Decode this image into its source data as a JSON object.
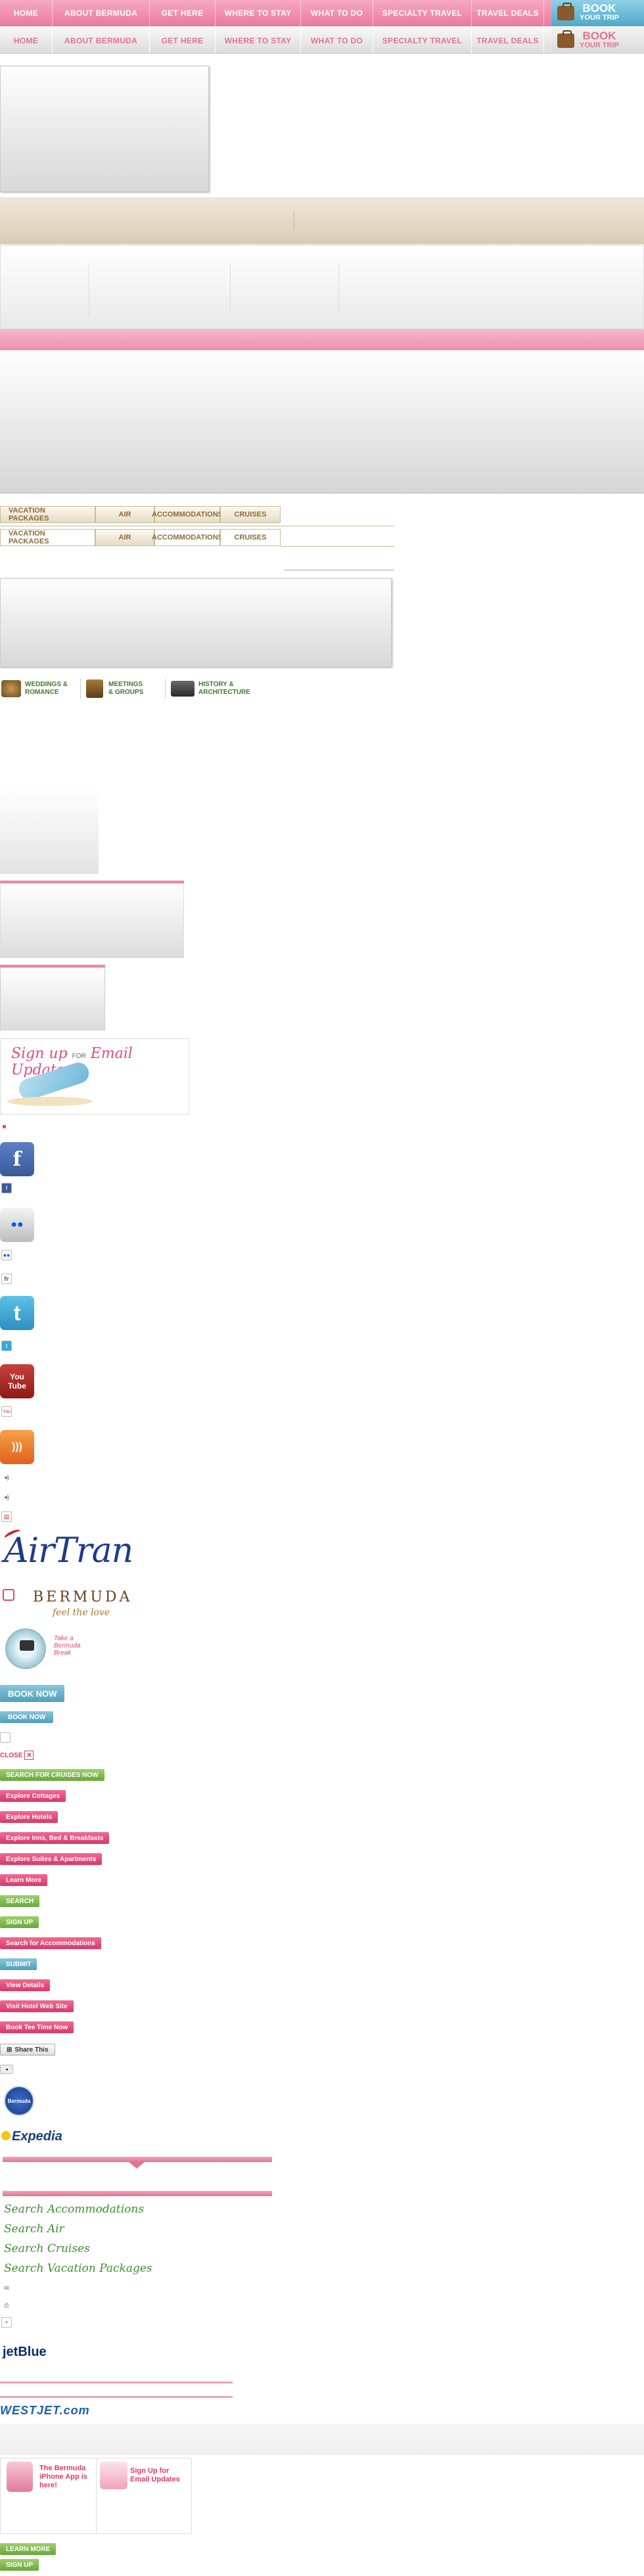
{
  "nav": {
    "items": [
      "HOME",
      "ABOUT BERMUDA",
      "GET HERE",
      "WHERE TO STAY",
      "WHAT TO DO",
      "SPECIALTY TRAVEL",
      "TRAVEL DEALS"
    ],
    "book_line1": "BOOK",
    "book_line2": "YOUR TRIP"
  },
  "tabs": [
    "VACATION PACKAGES",
    "AIR",
    "ACCOMMODATIONS",
    "CRUISES"
  ],
  "links": {
    "weddings": "WEDDINGS & ROMANCE",
    "meetings": "MEETINGS & GROUPS",
    "history": "HISTORY & ARCHITECTURE"
  },
  "signup_banner": {
    "line1": "Sign up",
    "for": "FOR",
    "line2": "Email Updates"
  },
  "social": {
    "facebook": "f",
    "flickr": "●●",
    "twitter": "t",
    "youtube": "You Tube",
    "rss": ")))"
  },
  "mini": {
    "flickr": "flr",
    "youtube": "You"
  },
  "logos": {
    "airtran": "AirTran",
    "bermuda": "BERMUDA",
    "bermuda_tag": "feel the love",
    "break_line1": "Take a",
    "break_line2": "Bermuda",
    "break_line3": "Break",
    "expedia": "Expedia",
    "jetblue": "jetBlue",
    "westjet": "WESTJET.com",
    "seal": "Bermuda"
  },
  "buttons": {
    "book_now_big": "BOOK NOW",
    "book_now_small": "BOOK NOW",
    "close": "CLOSE",
    "search_cruises": "SEARCH FOR CRUISES NOW",
    "explore_cottages": "Explore Cottages",
    "explore_hotels": "Explore Hotels",
    "explore_inns": "Explore Inns, Bed & Breakfasts",
    "explore_suites": "Explore Suites & Apartments",
    "learn_more": "Learn More",
    "search": "SEARCH",
    "sign_up": "SIGN UP",
    "search_accom": "Search for Accommodations",
    "submit": "SUBMIT",
    "view_details": "View Details",
    "visit_hotel": "Visit Hotel Web Site",
    "book_tee": "Book Tee Time Now",
    "share": "Share This",
    "learn_more2": "LEARN MORE",
    "sign_up2": "SIGN UP"
  },
  "search_links": [
    "Search Accommodations",
    "Search Air",
    "Search Cruises",
    "Search Vacation Packages"
  ],
  "promos": {
    "iphone": "The Bermuda iPhone App is here!",
    "email": "Sign Up for Email Updates"
  }
}
